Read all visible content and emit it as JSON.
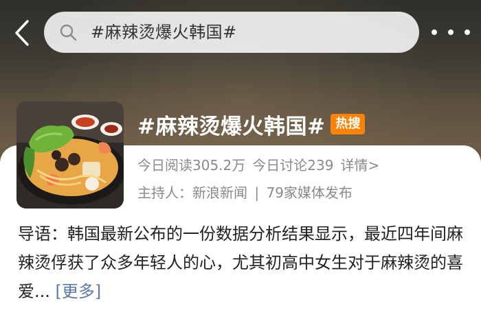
{
  "header": {
    "search_query": "#麻辣烫爆火韩国#"
  },
  "topic": {
    "title": "#麻辣烫爆火韩国#",
    "badge": "热搜",
    "reads": "今日阅读305.2万",
    "discussions": "今日讨论239",
    "details_link": "详情>",
    "host_label": "主持人：",
    "host_name": "新浪新闻",
    "divider": "|",
    "media_count": "79家媒体发布"
  },
  "intro": {
    "text": "导语：韩国最新公布的一份数据分析结果显示，最近四年间麻辣烫俘获了众多年轻人的心，尤其初高中女生对于麻辣烫的喜爱...",
    "more_label": "[更多]"
  },
  "icons": {
    "back": "chevron-left-icon",
    "search": "search-icon",
    "more": "more-dots-icon"
  },
  "colors": {
    "badge": "#ff8200",
    "link": "#5b78a6",
    "meta_text": "#8a8a8a"
  }
}
